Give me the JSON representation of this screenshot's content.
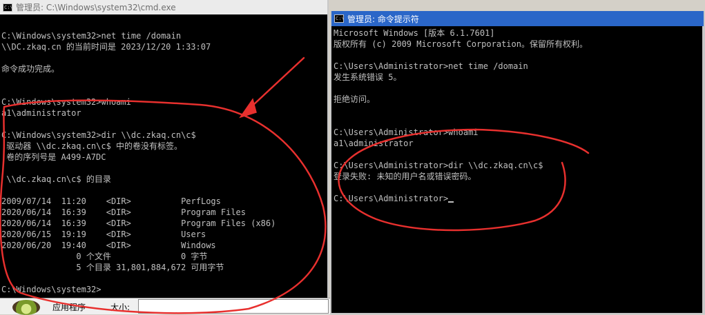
{
  "left_window": {
    "title": "管理员: C:\\Windows\\system32\\cmd.exe",
    "lines": [
      "C:\\Windows\\system32>net time /domain",
      "\\\\DC.zkaq.cn 的当前时间是 2023/12/20 1:33:07",
      "",
      "命令成功完成。",
      "",
      "",
      "C:\\Windows\\system32>whoami",
      "a1\\administrator",
      "",
      "C:\\Windows\\system32>dir \\\\dc.zkaq.cn\\c$",
      " 驱动器 \\\\dc.zkaq.cn\\c$ 中的卷没有标签。",
      " 卷的序列号是 A499-A7DC",
      "",
      " \\\\dc.zkaq.cn\\c$ 的目录",
      "",
      "2009/07/14  11:20    <DIR>          PerfLogs",
      "2020/06/14  16:39    <DIR>          Program Files",
      "2020/06/14  16:39    <DIR>          Program Files (x86)",
      "2020/06/15  19:19    <DIR>          Users",
      "2020/06/20  19:40    <DIR>          Windows",
      "               0 个文件              0 字节",
      "               5 个目录 31,801,884,672 可用字节",
      "",
      "C:\\Windows\\system32>"
    ]
  },
  "right_window": {
    "title": "管理员: 命令提示符",
    "lines": [
      "Microsoft Windows [版本 6.1.7601]",
      "版权所有 (c) 2009 Microsoft Corporation。保留所有权利。",
      "",
      "C:\\Users\\Administrator>net time /domain",
      "发生系统错误 5。",
      "",
      "拒绝访问。",
      "",
      "",
      "C:\\Users\\Administrator>whoami",
      "a1\\administrator",
      "",
      "C:\\Users\\Administrator>dir \\\\dc.zkaq.cn\\c$",
      "登录失败: 未知的用户名或错误密码。",
      "",
      "C:\\Users\\Administrator>"
    ]
  },
  "taskbar": {
    "app_label": "应用程序",
    "size_label": "大小:"
  },
  "colors": {
    "console_text": "#c0c0c0",
    "console_bg": "#000000",
    "annotation": "#e8302e",
    "active_title": "#2a66c8"
  }
}
